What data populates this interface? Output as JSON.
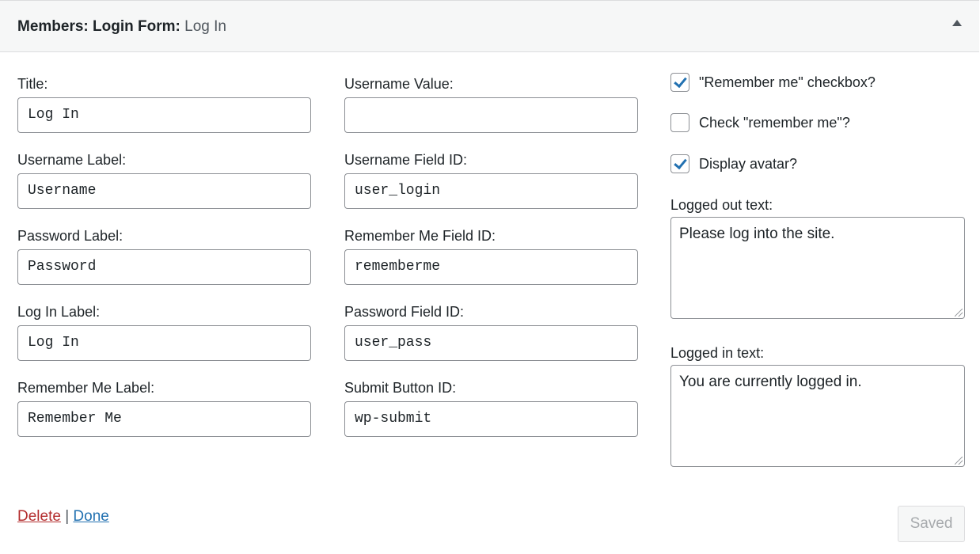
{
  "header": {
    "widget_name": "Members: Login Form:",
    "instance_title": "Log In"
  },
  "fields_left": [
    {
      "label": "Title:",
      "value": "Log In"
    },
    {
      "label": "Username Label:",
      "value": "Username"
    },
    {
      "label": "Password Label:",
      "value": "Password"
    },
    {
      "label": "Log In Label:",
      "value": "Log In"
    },
    {
      "label": "Remember Me Label:",
      "value": "Remember Me"
    }
  ],
  "fields_middle": [
    {
      "label": "Username Value:",
      "value": ""
    },
    {
      "label": "Username Field ID:",
      "value": "user_login"
    },
    {
      "label": "Remember Me Field ID:",
      "value": "rememberme"
    },
    {
      "label": "Password Field ID:",
      "value": "user_pass"
    },
    {
      "label": "Submit Button ID:",
      "value": "wp-submit"
    }
  ],
  "checkboxes": [
    {
      "label": "\"Remember me\" checkbox?",
      "checked": true
    },
    {
      "label": "Check \"remember me\"?",
      "checked": false
    },
    {
      "label": "Display avatar?",
      "checked": true
    }
  ],
  "logged_out": {
    "label": "Logged out text:",
    "value": "Please log into the site."
  },
  "logged_in": {
    "label": "Logged in text:",
    "value": "You are currently logged in."
  },
  "actions": {
    "delete": "Delete",
    "separator": "|",
    "done": "Done",
    "saved": "Saved"
  },
  "colors": {
    "accent": "#2271b1",
    "delete": "#b32d2e",
    "border": "#8c8f94"
  }
}
